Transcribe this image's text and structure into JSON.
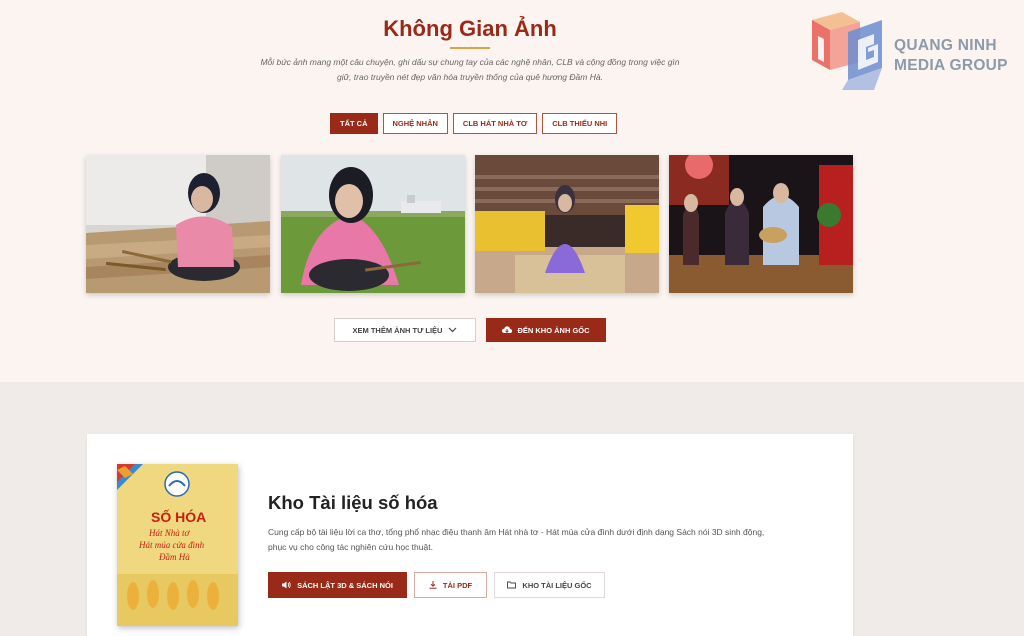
{
  "gallery": {
    "title": "Không Gian Ảnh",
    "subtitle": "Mỗi bức ảnh mang một câu chuyện, ghi dấu sự chung tay của các nghệ nhân, CLB và cộng đồng trong việc gìn giữ, trao truyền nét đẹp văn hóa truyền thống của quê hương Đầm Hà.",
    "tabs": [
      {
        "label": "TẤT CẢ",
        "active": true
      },
      {
        "label": "NGHỆ NHÂN",
        "active": false
      },
      {
        "label": "CLB HÁT NHÀ TƠ",
        "active": false
      },
      {
        "label": "CLB THIẾU NHI",
        "active": false
      }
    ],
    "more_button": "XEM THÊM ẢNH TƯ LIỆU",
    "archive_button": "ĐẾN KHO ẢNH GỐC"
  },
  "logo": {
    "line1": "QUANG NINH",
    "line2": "MEDIA GROUP",
    "colors": {
      "orange": "#f0a070",
      "red": "#e04848",
      "blue": "#6080c0",
      "gray": "#8d9aaa"
    }
  },
  "docs": {
    "title": "Kho Tài liệu số hóa",
    "description": "Cung cấp bộ tài liệu lời ca thơ, tổng phổ nhạc điệu thanh âm Hát nhà tơ - Hát múa cửa đình dưới định dạng Sách nói 3D sinh động, phục vụ cho công tác nghiên cứu học thuật.",
    "book": {
      "title": "SỐ HÓA",
      "subtitle_line1": "Hát Nhà tơ",
      "subtitle_line2": "Hát múa cửa đình",
      "subtitle_line3": "Đầm Hà"
    },
    "buttons": {
      "flipbook": "SÁCH LẬT 3D & SÁCH NÓI",
      "pdf": "TẢI PDF",
      "original": "KHO TÀI LIỆU GỐC"
    }
  },
  "colors": {
    "accent": "#9a2a18",
    "gold": "#d8a445",
    "background": "#fbf4f0",
    "section_bg": "#f0ebe8"
  }
}
